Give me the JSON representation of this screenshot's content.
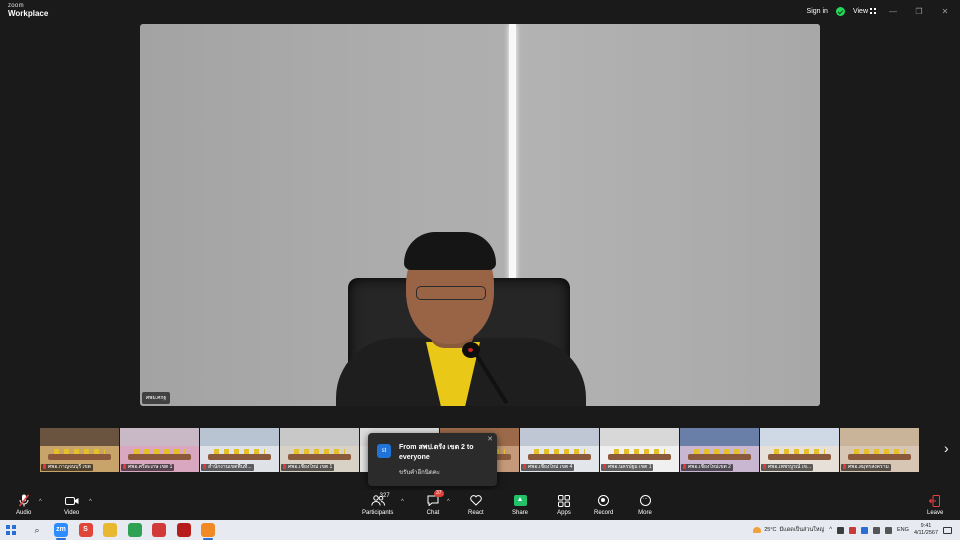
{
  "app": {
    "logo_top": "zoom",
    "logo_bottom": "Workplace"
  },
  "titlebar": {
    "sign_in": "Sign in",
    "view": "View",
    "minimize": "—",
    "restore": "❐",
    "close": "✕"
  },
  "main_video": {
    "name_label": "ศพม.ศกฐ"
  },
  "filmstrip": {
    "tiles": [
      {
        "label": "ศพอ.กาญจนบุรี เขต",
        "ceil": "#6a5440",
        "wall": "#c9a46a"
      },
      {
        "label": "ศพอ.ศรีสะเกษ เขต 1",
        "ceil": "#c9b8c6",
        "wall": "#d9a7c0"
      },
      {
        "label": "สำนักงานเขตพื้นที่...",
        "ceil": "#b8c4d2",
        "wall": "#dfe3e8"
      },
      {
        "label": "ศพอ.เชียงใหม่ เขต 1",
        "ceil": "#c8c8c8",
        "wall": "#d8d2c6"
      },
      {
        "label": "",
        "ceil": "#dcdcdc",
        "wall": "#e4e4e4"
      },
      {
        "label": "",
        "ceil": "#9c6a4a",
        "wall": "#c49a7a"
      },
      {
        "label": "ศพอ.เชียงใหม่ เขต 4",
        "ceil": "#bfc7d4",
        "wall": "#e3e6ea"
      },
      {
        "label": "ศพอ.นครปฐม เขต 1",
        "ceil": "#d8d8d8",
        "wall": "#f0f0f0"
      },
      {
        "label": "ศพอ.เชียงใหม่เขต 2",
        "ceil": "#6a7fa8",
        "wall": "#c9b6d0"
      },
      {
        "label": "ศพอ.เพชรบูรณ์ เข...",
        "ceil": "#cfd9e6",
        "wall": "#e6e0d8"
      },
      {
        "label": "ศพอ.สมุทรสงคราม",
        "ceil": "#c9b49a",
        "wall": "#d8c6b4"
      }
    ]
  },
  "chat_toast": {
    "icon": "st",
    "from": "From สพป.ตรัง เขต 2 to everyone",
    "message": "ขรับคำอีกนิดคะ",
    "close": "✕"
  },
  "toolbar": {
    "audio": "Audio",
    "video": "Video",
    "participants": "Participants",
    "participants_count": "327",
    "chat": "Chat",
    "chat_badge": "37",
    "react": "React",
    "share": "Share",
    "apps": "Apps",
    "record": "Record",
    "more": "More",
    "leave": "Leave",
    "caret": "^"
  },
  "taskbar": {
    "apps": [
      {
        "name": "zoom-app-icon",
        "text": "zm",
        "color": "#2d8cff"
      },
      {
        "name": "s-app-icon",
        "text": "S",
        "color": "#e0453a"
      },
      {
        "name": "file-explorer-icon",
        "text": "",
        "color": "#e8b830"
      },
      {
        "name": "chrome-icon",
        "text": "",
        "color": "#2fa152"
      },
      {
        "name": "acrobat-icon",
        "text": "",
        "color": "#d23a3a"
      },
      {
        "name": "browser-icon",
        "text": "",
        "color": "#b71c1c"
      },
      {
        "name": "media-app-icon",
        "text": "",
        "color": "#f08a24"
      }
    ],
    "weather_temp": "25°C",
    "weather_desc": "มีแดดเป็นส่วนใหญ่",
    "lang": "ENG",
    "time": "9:41",
    "date": "4/11/2567"
  }
}
